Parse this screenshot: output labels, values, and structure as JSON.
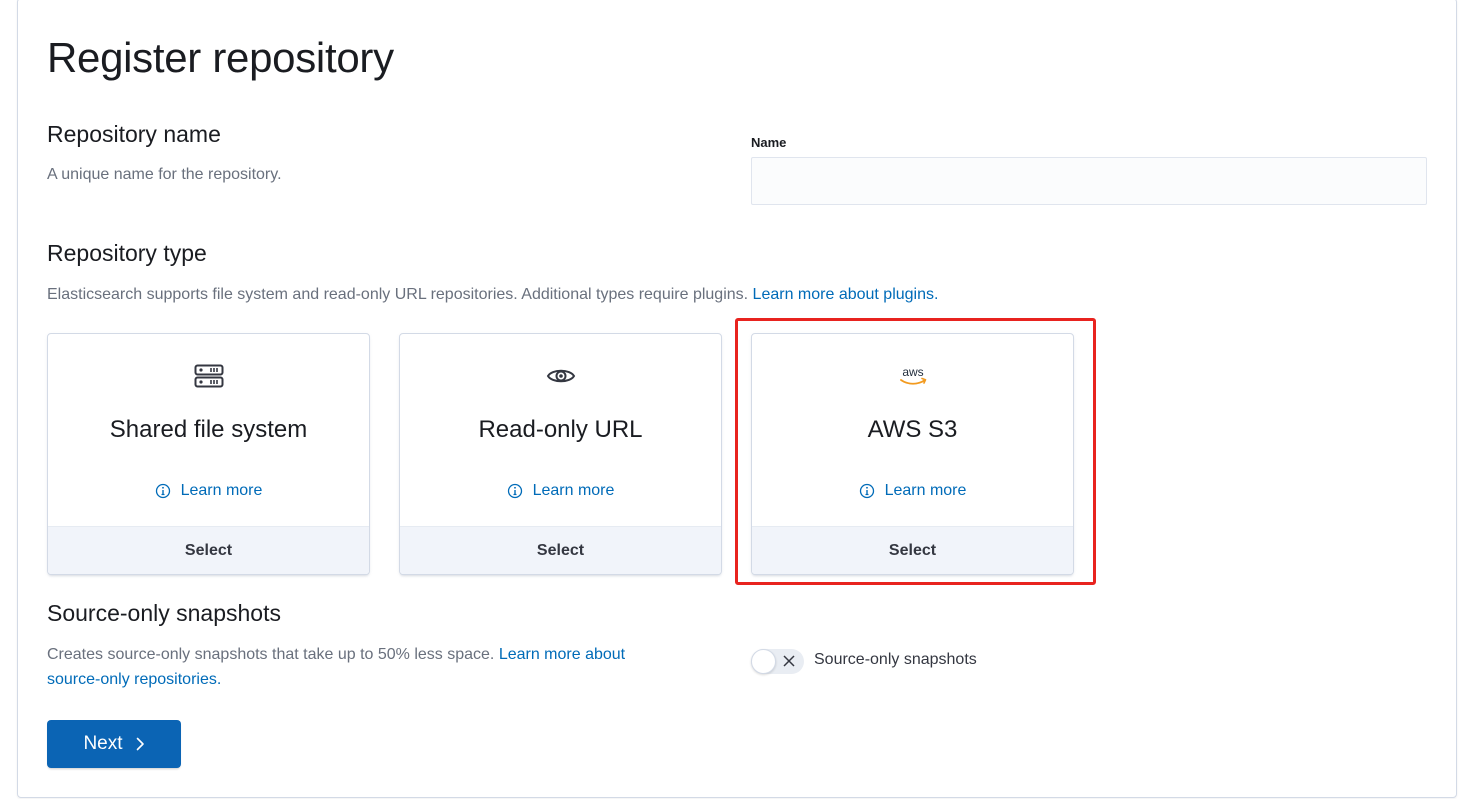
{
  "page": {
    "title": "Register repository"
  },
  "repository_name": {
    "title": "Repository name",
    "description": "A unique name for the repository.",
    "field_label": "Name",
    "value": "",
    "placeholder": ""
  },
  "repository_type": {
    "title": "Repository type",
    "description": "Elasticsearch supports file system and read-only URL repositories. Additional types require plugins.",
    "link": "Learn more about plugins.",
    "cards": [
      {
        "title": "Shared file system",
        "icon": "storage-icon",
        "learn_more": "Learn more",
        "select": "Select"
      },
      {
        "title": "Read-only URL",
        "icon": "eye-icon",
        "learn_more": "Learn more",
        "select": "Select"
      },
      {
        "title": "AWS S3",
        "icon": "aws-logo-icon",
        "icon_text": "aws",
        "learn_more": "Learn more",
        "select": "Select",
        "highlighted": true
      }
    ]
  },
  "source_only": {
    "title": "Source-only snapshots",
    "description": "Creates source-only snapshots that take up to 50% less space.",
    "link_line1": "Learn more about",
    "link_line2": "source-only repositories.",
    "toggle_label": "Source-only snapshots",
    "toggle_on": false
  },
  "footer": {
    "next_label": "Next"
  },
  "colors": {
    "link": "#006bb8",
    "primary_button": "#0b64b4",
    "highlight": "#e8231f",
    "aws_orange": "#f29a1f"
  }
}
